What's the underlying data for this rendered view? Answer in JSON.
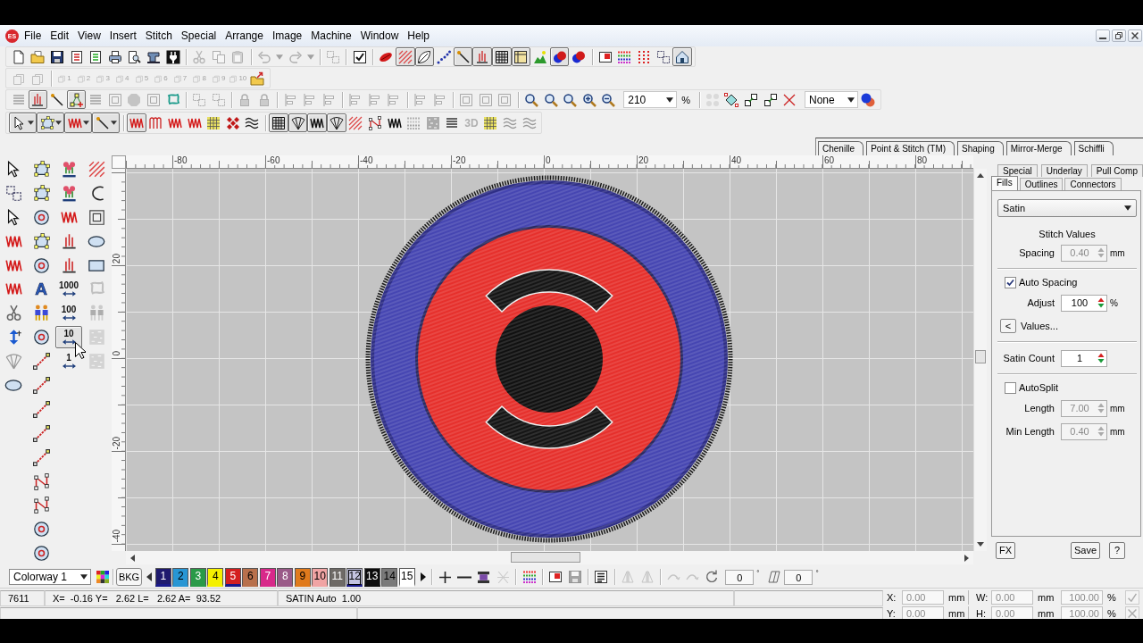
{
  "app": {
    "logo": "ES",
    "menu": [
      "File",
      "Edit",
      "View",
      "Insert",
      "Stitch",
      "Special",
      "Arrange",
      "Image",
      "Machine",
      "Window",
      "Help"
    ]
  },
  "toolbars": [
    {
      "groups": [
        [
          {
            "pressed": false,
            "disabled": false
          },
          {
            "pressed": false,
            "disabled": false
          },
          {
            "pressed": false,
            "disabled": false
          },
          {
            "pressed": false,
            "disabled": false
          },
          {
            "pressed": false,
            "disabled": false
          },
          {
            "pressed": false,
            "disabled": false
          },
          {
            "pressed": false,
            "disabled": false
          },
          {
            "pressed": false,
            "disabled": false
          },
          {
            "pressed": false,
            "disabled": false
          }
        ],
        [
          {
            "pressed": false,
            "disabled": true
          },
          {
            "pressed": false,
            "disabled": true
          },
          {
            "pressed": false,
            "disabled": true
          }
        ],
        [
          {
            "pressed": false,
            "disabled": true
          },
          {
            "pressed": false,
            "disabled": true
          },
          {
            "pressed": false,
            "disabled": true
          },
          {
            "pressed": false,
            "disabled": true
          }
        ],
        [
          {
            "pressed": false,
            "disabled": true
          }
        ],
        [
          {
            "pressed": false,
            "disabled": false
          }
        ],
        [
          {
            "pressed": false,
            "disabled": false
          },
          {
            "pressed": true,
            "disabled": false
          },
          {
            "pressed": true,
            "disabled": false
          },
          {
            "pressed": false,
            "disabled": false
          },
          {
            "pressed": true,
            "disabled": false
          },
          {
            "pressed": true,
            "disabled": false
          },
          {
            "pressed": true,
            "disabled": false
          },
          {
            "pressed": true,
            "disabled": false
          },
          {
            "pressed": false,
            "disabled": false
          },
          {
            "pressed": true,
            "disabled": false
          },
          {
            "pressed": false,
            "disabled": false
          }
        ],
        [
          {
            "pressed": false,
            "disabled": false
          },
          {
            "pressed": false,
            "disabled": false
          },
          {
            "pressed": false,
            "disabled": false
          },
          {
            "pressed": false,
            "disabled": false
          },
          {
            "pressed": true,
            "disabled": false
          }
        ]
      ]
    },
    {
      "groups": [
        [
          {
            "pressed": false,
            "disabled": true
          },
          {
            "pressed": false,
            "disabled": true
          }
        ],
        [
          {
            "label": "1",
            "pressed": false,
            "disabled": true
          },
          {
            "label": "2",
            "pressed": false,
            "disabled": true
          },
          {
            "label": "3",
            "pressed": false,
            "disabled": true
          },
          {
            "label": "4",
            "pressed": false,
            "disabled": true
          },
          {
            "label": "5",
            "pressed": false,
            "disabled": true
          },
          {
            "label": "6",
            "pressed": false,
            "disabled": true
          },
          {
            "label": "7",
            "pressed": false,
            "disabled": true
          },
          {
            "label": "8",
            "pressed": false,
            "disabled": true
          },
          {
            "label": "9",
            "pressed": false,
            "disabled": true
          },
          {
            "label": "10",
            "pressed": false,
            "disabled": true
          },
          {
            "pressed": false,
            "disabled": false
          }
        ]
      ]
    },
    {
      "groups": [
        [
          {
            "pressed": false,
            "disabled": true
          },
          {
            "pressed": true,
            "disabled": false
          },
          {
            "pressed": false,
            "disabled": false
          },
          {
            "pressed": true,
            "disabled": false
          },
          {
            "pressed": false,
            "disabled": true
          },
          {
            "pressed": false,
            "disabled": true
          },
          {
            "pressed": false,
            "disabled": true
          },
          {
            "pressed": false,
            "disabled": true
          },
          {
            "pressed": false,
            "disabled": false
          }
        ],
        [
          {
            "pressed": false,
            "disabled": true
          },
          {
            "pressed": false,
            "disabled": true
          }
        ],
        [
          {
            "pressed": false,
            "disabled": true
          },
          {
            "pressed": false,
            "disabled": true
          }
        ],
        [
          {
            "pressed": false,
            "disabled": true
          },
          {
            "pressed": false,
            "disabled": true
          },
          {
            "pressed": false,
            "disabled": true
          }
        ],
        [
          {
            "pressed": false,
            "disabled": true
          },
          {
            "pressed": false,
            "disabled": true
          },
          {
            "pressed": false,
            "disabled": true
          }
        ],
        [
          {
            "pressed": false,
            "disabled": true
          },
          {
            "pressed": false,
            "disabled": true
          }
        ],
        [
          {
            "pressed": false,
            "disabled": true
          },
          {
            "pressed": false,
            "disabled": true
          },
          {
            "pressed": false,
            "disabled": true
          }
        ],
        [
          {
            "kind": "button",
            "pressed": false,
            "disabled": false
          },
          {
            "kind": "button",
            "pressed": false,
            "disabled": false
          },
          {
            "kind": "button",
            "pressed": false,
            "disabled": false
          },
          {
            "kind": "button",
            "pressed": false,
            "disabled": false
          },
          {
            "kind": "button",
            "pressed": false,
            "disabled": false
          },
          {
            "kind": "combo",
            "value": "210",
            "unit": "%"
          }
        ],
        [
          {
            "kind": "button",
            "pressed": false,
            "disabled": true
          },
          {
            "kind": "button",
            "pressed": false,
            "disabled": false
          },
          {
            "kind": "button",
            "pressed": false,
            "disabled": false
          },
          {
            "kind": "button",
            "pressed": false,
            "disabled": false
          },
          {
            "kind": "button",
            "pressed": false,
            "disabled": false
          },
          {
            "kind": "combo",
            "value": "None"
          },
          {
            "kind": "button",
            "pressed": false,
            "disabled": false
          }
        ]
      ]
    },
    {
      "groups": [
        [
          {
            "pressed": true,
            "disabled": false
          },
          {
            "pressed": true,
            "disabled": false
          },
          {
            "pressed": true,
            "disabled": false
          },
          {
            "pressed": true,
            "disabled": false
          }
        ],
        [
          {
            "pressed": true,
            "disabled": false
          },
          {
            "pressed": false,
            "disabled": false
          },
          {
            "pressed": false,
            "disabled": false
          },
          {
            "pressed": false,
            "disabled": false
          },
          {
            "pressed": false,
            "disabled": false
          },
          {
            "pressed": false,
            "disabled": false
          },
          {
            "pressed": false,
            "disabled": false
          }
        ],
        [
          {
            "pressed": true,
            "disabled": false
          },
          {
            "pressed": true,
            "disabled": false
          },
          {
            "pressed": true,
            "disabled": false
          },
          {
            "pressed": true,
            "disabled": false
          },
          {
            "pressed": false,
            "disabled": false
          },
          {
            "pressed": false,
            "disabled": false
          },
          {
            "pressed": false,
            "disabled": false
          },
          {
            "pressed": false,
            "disabled": true
          },
          {
            "pressed": false,
            "disabled": false
          },
          {
            "pressed": false,
            "disabled": false
          },
          {
            "label": "3D",
            "pressed": false,
            "disabled": true
          },
          {
            "pressed": false,
            "disabled": false
          },
          {
            "pressed": false,
            "disabled": true
          },
          {
            "pressed": false,
            "disabled": true
          }
        ]
      ]
    }
  ],
  "feature_tabs": [
    {
      "label": "Chenille",
      "selected": false
    },
    {
      "label": "Point & Stitch (TM)",
      "selected": false
    },
    {
      "label": "Shaping",
      "selected": false
    },
    {
      "label": "Mirror-Merge",
      "selected": false
    },
    {
      "label": "Schiffli",
      "selected": false
    }
  ],
  "toolbox": {
    "columns": [
      [
        {
          "pressed": false,
          "disabled": false
        },
        {
          "pressed": false,
          "disabled": false
        },
        {
          "pressed": false,
          "disabled": false
        },
        {
          "pressed": false,
          "disabled": false
        },
        {
          "pressed": false,
          "disabled": false
        },
        {
          "pressed": false,
          "disabled": false
        },
        {
          "pressed": false,
          "disabled": false
        },
        {
          "pressed": false,
          "disabled": false
        },
        {
          "pressed": false,
          "disabled": true
        },
        {
          "pressed": false,
          "disabled": false
        }
      ],
      [
        {
          "pressed": false,
          "disabled": false
        },
        {
          "pressed": false,
          "disabled": false
        },
        {
          "pressed": false,
          "disabled": false
        },
        {
          "pressed": false,
          "disabled": false
        },
        {
          "pressed": false,
          "disabled": false
        },
        {
          "label": "A",
          "pressed": false,
          "disabled": false
        },
        {
          "pressed": false,
          "disabled": false
        },
        {
          "pressed": false,
          "disabled": false
        },
        {
          "pressed": false,
          "disabled": false
        },
        {
          "pressed": false,
          "disabled": false
        },
        {
          "pressed": false,
          "disabled": false
        },
        {
          "pressed": false,
          "disabled": false
        },
        {
          "pressed": false,
          "disabled": false
        },
        {
          "pressed": false,
          "disabled": false
        },
        {
          "pressed": false,
          "disabled": false
        },
        {
          "pressed": false,
          "disabled": false
        },
        {
          "pressed": false,
          "disabled": false
        }
      ],
      [
        {
          "pressed": false,
          "disabled": false
        },
        {
          "pressed": false,
          "disabled": false
        },
        {
          "pressed": false,
          "disabled": false
        },
        {
          "pressed": false,
          "disabled": false
        },
        {
          "pressed": false,
          "disabled": false
        },
        {
          "label": "1000",
          "pressed": false,
          "disabled": false
        },
        {
          "label": "100",
          "pressed": false,
          "disabled": false
        },
        {
          "label": "10",
          "pressed": true,
          "disabled": false
        },
        {
          "label": "1",
          "pressed": false,
          "disabled": false
        }
      ],
      [
        {
          "pressed": false,
          "disabled": false
        },
        {
          "pressed": false,
          "disabled": false
        },
        {
          "pressed": false,
          "disabled": false
        },
        {
          "pressed": false,
          "disabled": false
        },
        {
          "pressed": false,
          "disabled": false
        },
        {
          "pressed": false,
          "disabled": true
        },
        {
          "pressed": false,
          "disabled": true
        },
        {
          "pressed": false,
          "disabled": true
        },
        {
          "pressed": false,
          "disabled": true
        }
      ]
    ]
  },
  "rulers": {
    "horizontal": [
      "-80",
      "-60",
      "-40",
      "-20",
      "0",
      "20",
      "40",
      "60",
      "80"
    ],
    "vertical": [
      "20",
      "0",
      "-20",
      "-40"
    ]
  },
  "properties": {
    "tab_rows": [
      [
        {
          "label": "Special",
          "selected": false
        },
        {
          "label": "Underlay",
          "selected": false
        },
        {
          "label": "Pull Comp",
          "selected": false
        }
      ],
      [
        {
          "label": "Fills",
          "selected": true
        },
        {
          "label": "Outlines",
          "selected": false
        },
        {
          "label": "Connectors",
          "selected": false
        }
      ]
    ],
    "fill_type": "Satin",
    "section_title": "Stitch Values",
    "rows": [
      {
        "kind": "field",
        "label": "Spacing",
        "value": "0.40",
        "unit": "mm",
        "disabled": true
      },
      {
        "kind": "divider"
      },
      {
        "kind": "check",
        "label": "Auto Spacing",
        "checked": true
      },
      {
        "kind": "field",
        "label": "Adjust",
        "value": "100",
        "unit": "%",
        "disabled": false
      },
      {
        "kind": "button",
        "label": "<",
        "text": "Values..."
      },
      {
        "kind": "divider"
      },
      {
        "kind": "field",
        "label": "Satin Count",
        "value": "1",
        "disabled": false
      },
      {
        "kind": "divider"
      },
      {
        "kind": "check",
        "label": "AutoSplit",
        "checked": false
      },
      {
        "kind": "field",
        "label": "Length",
        "value": "7.00",
        "unit": "mm",
        "disabled": true
      },
      {
        "kind": "field",
        "label": "Min Length",
        "value": "0.40",
        "unit": "mm",
        "disabled": true
      }
    ],
    "footer_buttons": [
      "FX",
      "Save",
      "?"
    ]
  },
  "color_bar": {
    "colorway": "Colorway 1",
    "background_button": "BKG",
    "swatches": [
      {
        "label": "1",
        "color": "#1f1a6e",
        "selected": false,
        "in_use": true
      },
      {
        "label": "2",
        "color": "#2896d4",
        "selected": false,
        "in_use": false
      },
      {
        "label": "3",
        "color": "#2a9a48",
        "selected": false,
        "in_use": false
      },
      {
        "label": "4",
        "color": "#f4f000",
        "selected": false,
        "in_use": false
      },
      {
        "label": "5",
        "color": "#d42020",
        "selected": false,
        "in_use": true
      },
      {
        "label": "6",
        "color": "#b8704c",
        "selected": false,
        "in_use": false
      },
      {
        "label": "7",
        "color": "#d8288a",
        "selected": false,
        "in_use": false
      },
      {
        "label": "8",
        "color": "#9a5a88",
        "selected": false,
        "in_use": false
      },
      {
        "label": "9",
        "color": "#e07a1c",
        "selected": false,
        "in_use": false
      },
      {
        "label": "10",
        "color": "#f0a4a4",
        "selected": false,
        "in_use": false
      },
      {
        "label": "11",
        "color": "#6e6a66",
        "selected": false,
        "in_use": false
      },
      {
        "label": "12",
        "color": "#c4c4e0",
        "selected": true,
        "in_use": true
      },
      {
        "label": "13",
        "color": "#0c0c0c",
        "selected": false,
        "in_use": false
      },
      {
        "label": "14",
        "color": "#7a7a7a",
        "selected": false,
        "in_use": false
      },
      {
        "label": "15",
        "color": "#ffffff",
        "selected": false,
        "in_use": false
      }
    ],
    "tools": {
      "groups": [
        [
          {
            "pressed": false,
            "disabled": false
          },
          {
            "pressed": false,
            "disabled": false
          },
          {
            "pressed": false,
            "disabled": false
          },
          {
            "pressed": false,
            "disabled": true
          }
        ],
        [
          {
            "pressed": false,
            "disabled": false
          }
        ],
        [
          {
            "pressed": false,
            "disabled": false
          },
          {
            "pressed": false,
            "disabled": true
          }
        ],
        [
          {
            "pressed": false,
            "disabled": false
          }
        ],
        [
          {
            "pressed": false,
            "disabled": true
          },
          {
            "pressed": false,
            "disabled": true
          }
        ],
        [
          {
            "pressed": false,
            "disabled": true
          },
          {
            "pressed": false,
            "disabled": true
          },
          {
            "pressed": false,
            "disabled": false
          }
        ]
      ]
    },
    "angle_fields": [
      {
        "value": "0",
        "unit": "°"
      },
      {
        "value": "0",
        "unit": "°"
      }
    ]
  },
  "status_bar": {
    "stitch_count": "7611",
    "coordinates": "X=  -0.16 Y=   2.62 L=   2.62 A=  93.52",
    "stitch_info": "SATIN Auto  1.00",
    "position": [
      {
        "label": "X:",
        "value": "0.00",
        "unit": "mm",
        "disabled": true
      },
      {
        "label": "Y:",
        "value": "0.00",
        "unit": "mm",
        "disabled": true
      }
    ],
    "size": [
      {
        "label": "W:",
        "value": "0.00",
        "unit": "mm",
        "scale": "100.00",
        "scale_unit": "%",
        "disabled": true
      },
      {
        "label": "H:",
        "value": "0.00",
        "unit": "mm",
        "scale": "100.00",
        "scale_unit": "%",
        "disabled": true
      }
    ]
  }
}
